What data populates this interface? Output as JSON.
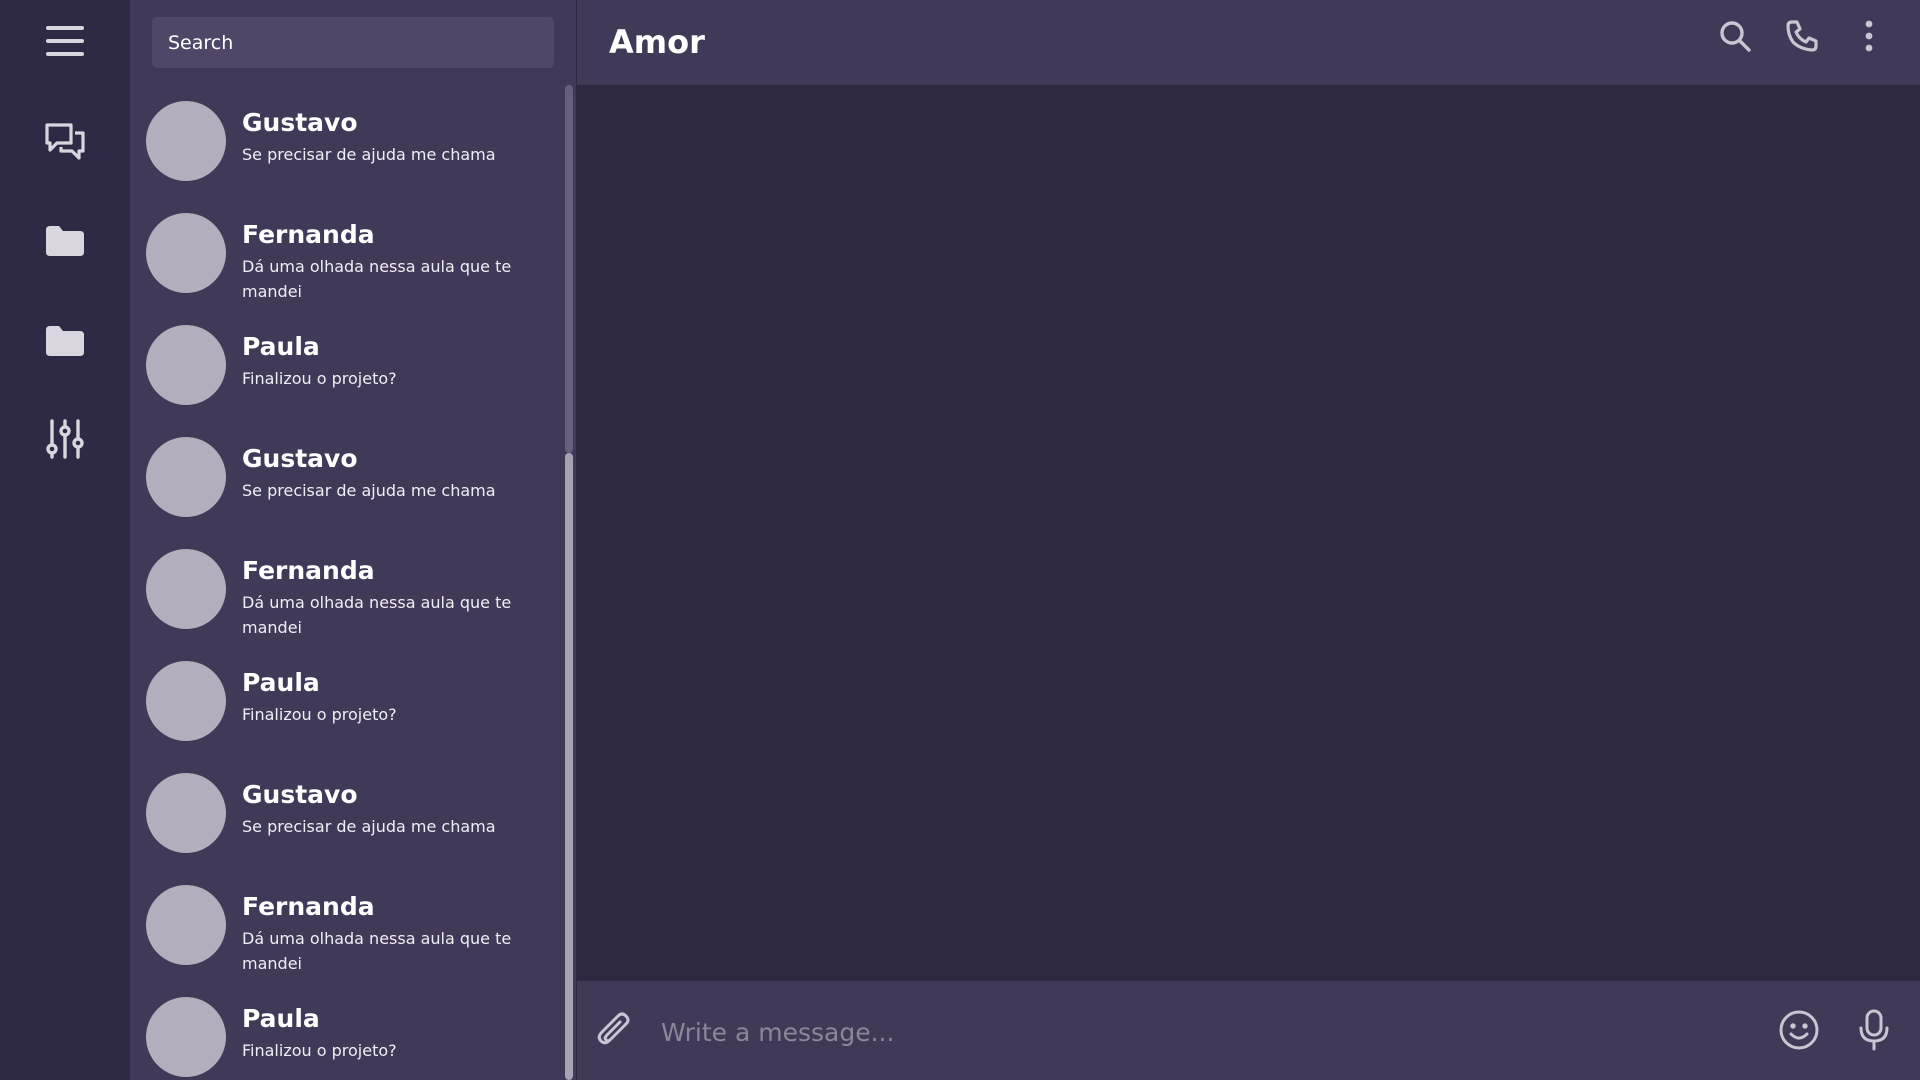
{
  "sidebar": {
    "icons": [
      "menu-icon",
      "chat-bubbles-icon",
      "folder-icon",
      "folder-icon",
      "sliders-icon"
    ]
  },
  "search": {
    "placeholder": "Search"
  },
  "conversations": [
    {
      "name": "Gustavo",
      "preview": "Se precisar de ajuda me chama"
    },
    {
      "name": "Fernanda",
      "preview": "Dá uma olhada nessa aula que te mandei"
    },
    {
      "name": "Paula",
      "preview": "Finalizou o projeto?"
    },
    {
      "name": "Gustavo",
      "preview": "Se precisar de ajuda me chama"
    },
    {
      "name": "Fernanda",
      "preview": "Dá uma olhada nessa aula que te mandei"
    },
    {
      "name": "Paula",
      "preview": "Finalizou o projeto?"
    },
    {
      "name": "Gustavo",
      "preview": "Se precisar de ajuda me chama"
    },
    {
      "name": "Fernanda",
      "preview": "Dá uma olhada nessa aula que te mandei"
    },
    {
      "name": "Paula",
      "preview": "Finalizou o projeto?"
    }
  ],
  "chat": {
    "title": "Amor",
    "header_icons": [
      "search-icon",
      "phone-icon",
      "more-vertical-icon"
    ]
  },
  "composer": {
    "placeholder": "Write a message...",
    "icons": [
      "paperclip-icon",
      "emoji-icon",
      "microphone-icon"
    ]
  },
  "colors": {
    "rail_bg": "#2e2a45",
    "panel_bg": "#403957",
    "chat_bg": "#2e2842",
    "avatar": "#b3aebd",
    "search_bg": "#4e4767"
  }
}
